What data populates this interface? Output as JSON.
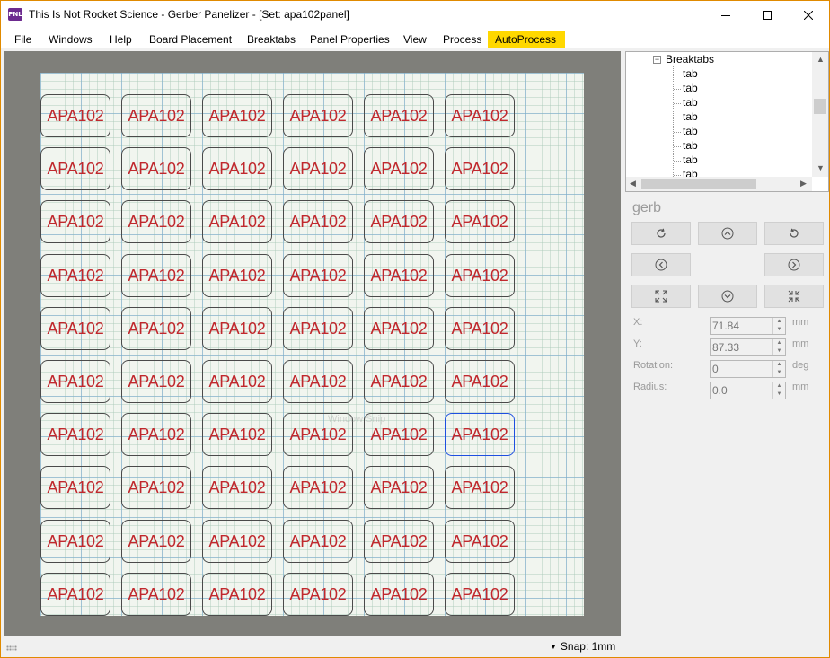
{
  "window": {
    "app_icon_text": "PNL",
    "title": "This Is Not Rocket Science - Gerber Panelizer - [Set: apa102panel]"
  },
  "menu": {
    "items": [
      "File",
      "Windows",
      "Help",
      "Board Placement",
      "Breaktabs",
      "Panel Properties",
      "View",
      "Process",
      "AutoProcess"
    ]
  },
  "canvas": {
    "board_label": "APA102",
    "rows": 10,
    "cols": 6,
    "selected": {
      "row": 6,
      "col": 5
    },
    "watermark": "Window Snip"
  },
  "tree": {
    "root_expander": "−",
    "root_label": "Breaktabs",
    "children": [
      "tab",
      "tab",
      "tab",
      "tab",
      "tab",
      "tab",
      "tab",
      "tab"
    ],
    "scroll_up": "▲",
    "scroll_down": "▼",
    "scroll_left": "◀",
    "scroll_right": "▶"
  },
  "panel": {
    "title": "gerb",
    "fields": [
      {
        "label": "X:",
        "value": "71.84",
        "unit": "mm"
      },
      {
        "label": "Y:",
        "value": "87.33",
        "unit": "mm"
      },
      {
        "label": "Rotation:",
        "value": "0",
        "unit": "deg"
      },
      {
        "label": "Radius:",
        "value": "0.0",
        "unit": "mm"
      }
    ],
    "spin_up": "▲",
    "spin_down": "▼"
  },
  "statusbar": {
    "snap_arrow": "▼",
    "snap_label": "Snap: 1mm"
  },
  "colors": {
    "accent_menu": "#ffd800",
    "board_text": "#c0282d",
    "selected_outline": "#1e4fe0",
    "window_border": "#e08a00"
  }
}
